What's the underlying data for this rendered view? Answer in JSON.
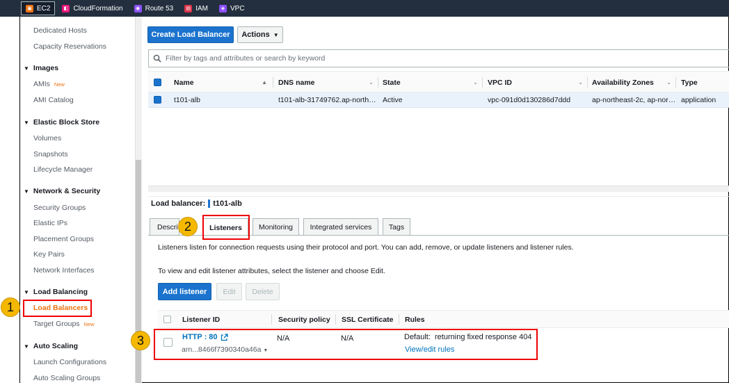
{
  "topbar": {
    "services": [
      {
        "label": "EC2",
        "icon": "ec2-icon",
        "color": "#ec7211",
        "active": true
      },
      {
        "label": "CloudFormation",
        "icon": "cloudformation-icon",
        "color": "#e7157b"
      },
      {
        "label": "Route 53",
        "icon": "route53-icon",
        "color": "#8c4fff"
      },
      {
        "label": "IAM",
        "icon": "iam-icon",
        "color": "#dd344c"
      },
      {
        "label": "VPC",
        "icon": "vpc-icon",
        "color": "#8c4fff"
      }
    ]
  },
  "sidebar": {
    "items": [
      {
        "label": "Dedicated Hosts"
      },
      {
        "label": "Capacity Reservations"
      },
      {
        "label": "Images",
        "header": true
      },
      {
        "label": "AMIs",
        "badge": "New"
      },
      {
        "label": "AMI Catalog"
      },
      {
        "label": "Elastic Block Store",
        "header": true
      },
      {
        "label": "Volumes"
      },
      {
        "label": "Snapshots"
      },
      {
        "label": "Lifecycle Manager"
      },
      {
        "label": "Network & Security",
        "header": true
      },
      {
        "label": "Security Groups"
      },
      {
        "label": "Elastic IPs"
      },
      {
        "label": "Placement Groups"
      },
      {
        "label": "Key Pairs"
      },
      {
        "label": "Network Interfaces"
      },
      {
        "label": "Load Balancing",
        "header": true
      },
      {
        "label": "Load Balancers",
        "current": true
      },
      {
        "label": "Target Groups",
        "badge": "New"
      },
      {
        "label": "Auto Scaling",
        "header": true
      },
      {
        "label": "Launch Configurations"
      },
      {
        "label": "Auto Scaling Groups"
      }
    ]
  },
  "toolbar": {
    "create_label": "Create Load Balancer",
    "actions_label": "Actions"
  },
  "filter": {
    "placeholder": "Filter by tags and attributes or search by keyword"
  },
  "lb_table": {
    "columns": [
      "Name",
      "DNS name",
      "State",
      "VPC ID",
      "Availability Zones",
      "Type"
    ],
    "rows": [
      {
        "name": "t101-alb",
        "dns": "t101-alb-31749762.ap-north…",
        "state": "Active",
        "vpc": "vpc-091d0d130286d7ddd",
        "az": "ap-northeast-2c, ap-nor…",
        "type": "application"
      }
    ]
  },
  "details": {
    "label": "Load balancer:",
    "name": "t101-alb",
    "tabs": [
      "Descri",
      "Listeners",
      "Monitoring",
      "Integrated services",
      "Tags"
    ],
    "active_tab": "Listeners",
    "intro": "Listeners listen for connection requests using their protocol and port. You can add, remove, or update listeners and listener rules.",
    "edit_hint": "To view and edit listener attributes, select the listener and choose Edit.",
    "add_listener_label": "Add listener",
    "edit_label": "Edit",
    "delete_label": "Delete"
  },
  "listeners_table": {
    "columns": [
      "Listener ID",
      "Security policy",
      "SSL Certificate",
      "Rules"
    ],
    "rows": [
      {
        "id": "HTTP : 80",
        "arn": "arn...8466f7390340a46a",
        "security_policy": "N/A",
        "ssl": "N/A",
        "rule_default": "Default:  returning fixed response 404",
        "rule_link": "View/edit rules"
      }
    ]
  },
  "callouts": [
    "1",
    "2",
    "3"
  ]
}
